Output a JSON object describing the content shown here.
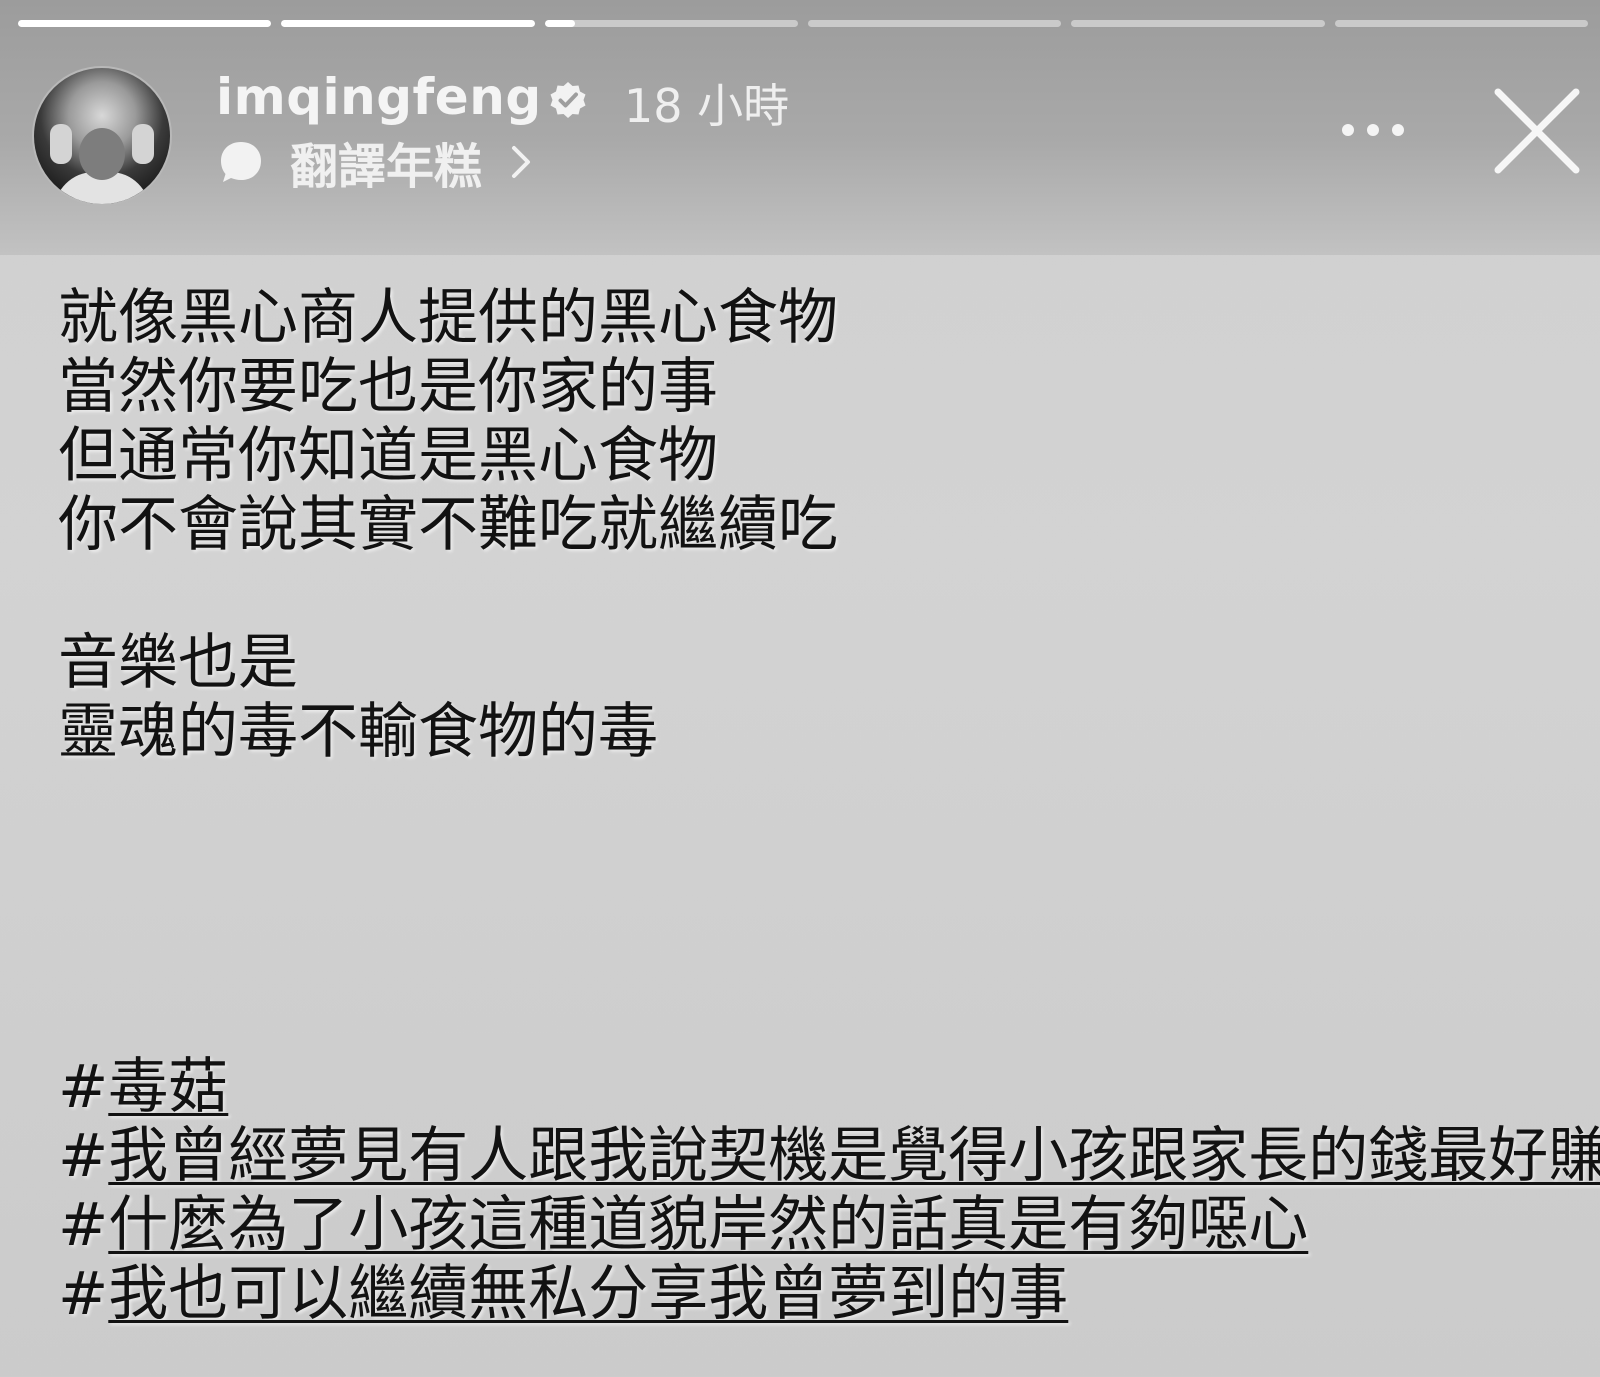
{
  "story": {
    "progress": [
      1.0,
      1.0,
      0.12,
      0.0,
      0.0,
      0.0
    ]
  },
  "header": {
    "username": "imqingfeng",
    "verified_icon": "verified-badge-icon",
    "time": "18 小時",
    "music_icon": "music-bubble-icon",
    "music_title": "翻譯年糕",
    "chevron_icon": "chevron-right-icon",
    "more_icon": "more-options-icon",
    "close_icon": "close-icon"
  },
  "caption": {
    "lines": [
      "就像黑心商人提供的黑心食物",
      "當然你要吃也是你家的事",
      "但通常你知道是黑心食物",
      "你不會說其實不難吃就繼續吃",
      "",
      "音樂也是",
      "靈魂的毒不輸食物的毒"
    ]
  },
  "hashtags": [
    "毒菇",
    "我曾經夢見有人跟我說契機是覺得小孩跟家長的錢最好賺",
    "什麼為了小孩這種道貌岸然的話真是有夠噁心",
    "我也可以繼續無私分享我曾夢到的事"
  ]
}
